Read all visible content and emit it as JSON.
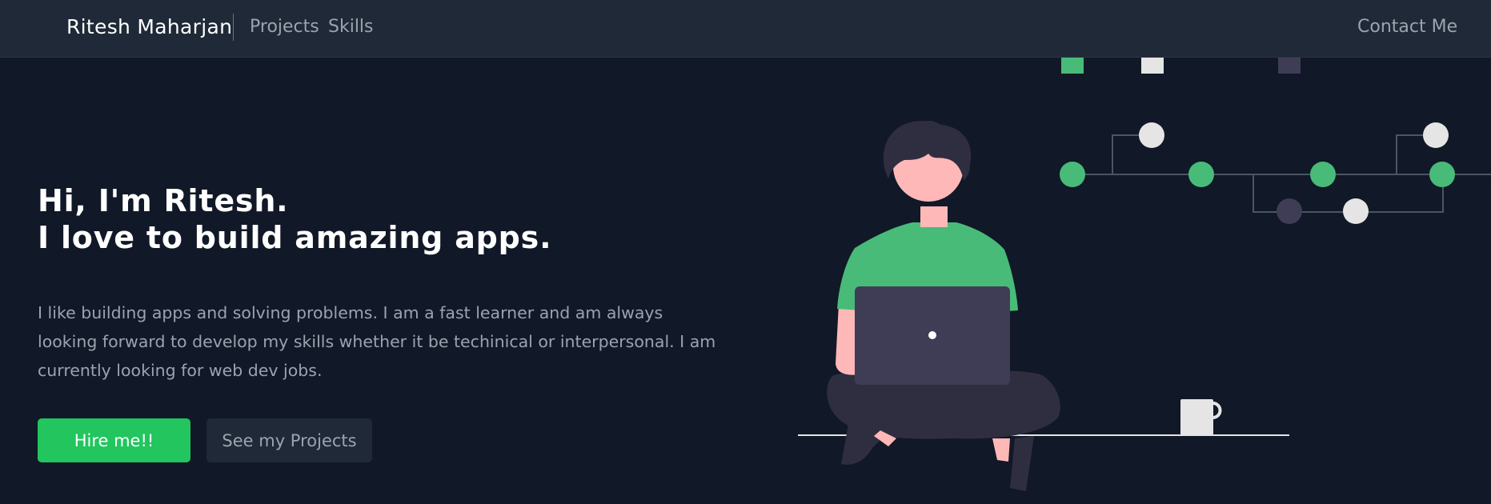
{
  "navbar": {
    "brand": "Ritesh Maharjan",
    "links": [
      "Projects",
      "Skills"
    ],
    "contact": "Contact Me"
  },
  "hero": {
    "title_lines": [
      "Hi, I'm Ritesh.",
      "I love to build amazing apps."
    ],
    "description": "I like building apps and solving problems. I am a fast learner and am always looking forward to develop my skills whether it be techinical or interpersonal. I am currently looking for web dev jobs.",
    "buttons": {
      "primary": "Hire me!!",
      "secondary": "See my Projects"
    }
  },
  "colors": {
    "background": "#111827",
    "navbar": "#1f2937",
    "accent": "#22c55e",
    "illustration_green": "#48bb78",
    "muted_text": "#9ca3af"
  },
  "illustration": {
    "icon": "developer-with-laptop-illustration"
  }
}
